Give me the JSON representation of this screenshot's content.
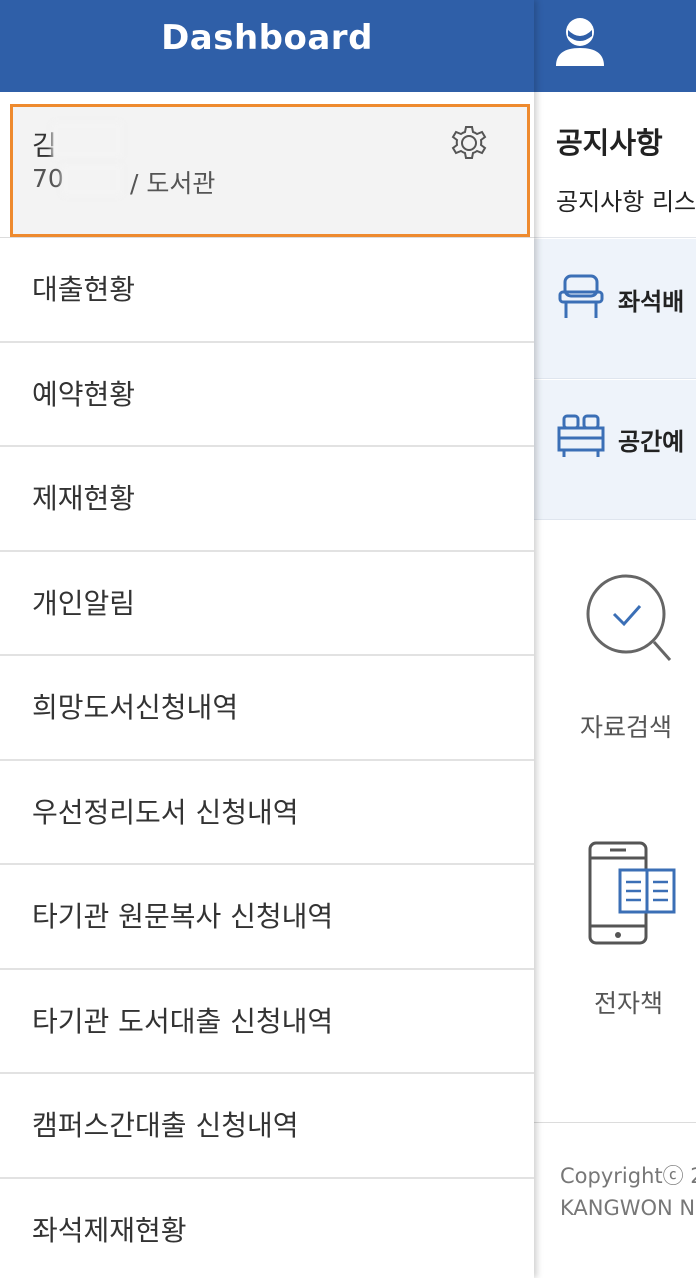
{
  "drawer": {
    "title": "Dashboard",
    "profile": {
      "name": "김",
      "id": "70",
      "affiliation": "/ 도서관"
    },
    "menu_items": [
      {
        "label": "대출현황"
      },
      {
        "label": "예약현황"
      },
      {
        "label": "제재현황"
      },
      {
        "label": "개인알림"
      },
      {
        "label": "희망도서신청내역"
      },
      {
        "label": "우선정리도서 신청내역"
      },
      {
        "label": "타기관 원문복사 신청내역"
      },
      {
        "label": "타기관 도서대출 신청내역"
      },
      {
        "label": "캠퍼스간대출 신청내역"
      },
      {
        "label": "좌석제재현황"
      }
    ]
  },
  "background_page": {
    "notice_title": "공지사항",
    "notice_subtitle": "공지사항 리스",
    "seat_label": "좌석배",
    "space_label": "공간예",
    "search_label": "자료검색",
    "ebook_label": "전자책",
    "copyright": "Copyrightⓒ 2",
    "university": "KANGWON N"
  },
  "colors": {
    "header_blue": "#2f5fa8",
    "highlight_orange": "#ee8a2e",
    "band_bg": "#eef3fa",
    "icon_blue": "#3b6fb6"
  },
  "icons": {
    "user": "user-avatar-icon",
    "settings": "gear-icon",
    "seat": "chair-icon",
    "space": "desk-icon",
    "search": "magnifier-check-icon",
    "ebook": "tablet-book-icon"
  }
}
